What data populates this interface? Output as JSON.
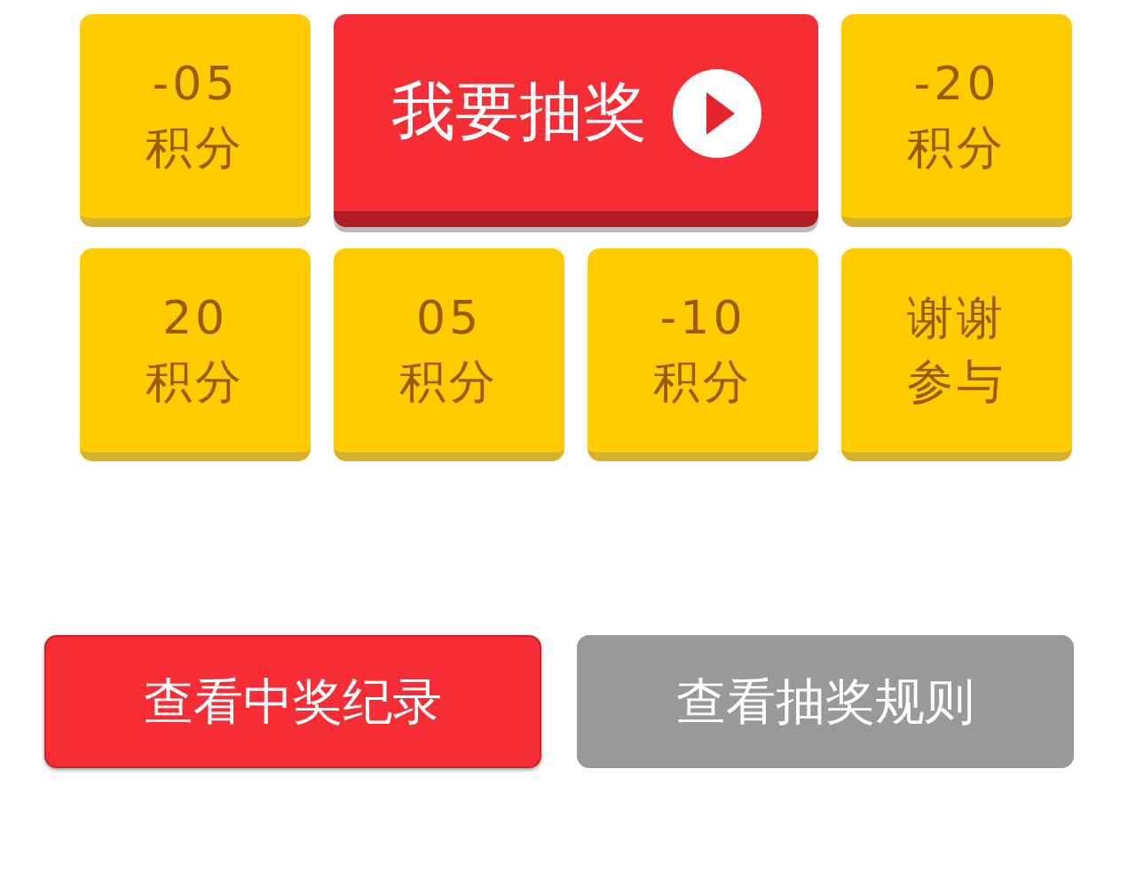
{
  "prizes": [
    {
      "amount": "-05",
      "unit": "积分"
    },
    {
      "amount": "-20",
      "unit": "积分"
    },
    {
      "amount": "20",
      "unit": "积分"
    },
    {
      "amount": "05",
      "unit": "积分"
    },
    {
      "amount": "-10",
      "unit": "积分"
    },
    {
      "amount": "谢谢",
      "unit": "参与"
    }
  ],
  "draw_button": {
    "label": "我要抽奖"
  },
  "actions": [
    {
      "label": "查看中奖纪录",
      "kind": "primary"
    },
    {
      "label": "查看抽奖规则",
      "kind": "secondary"
    }
  ]
}
